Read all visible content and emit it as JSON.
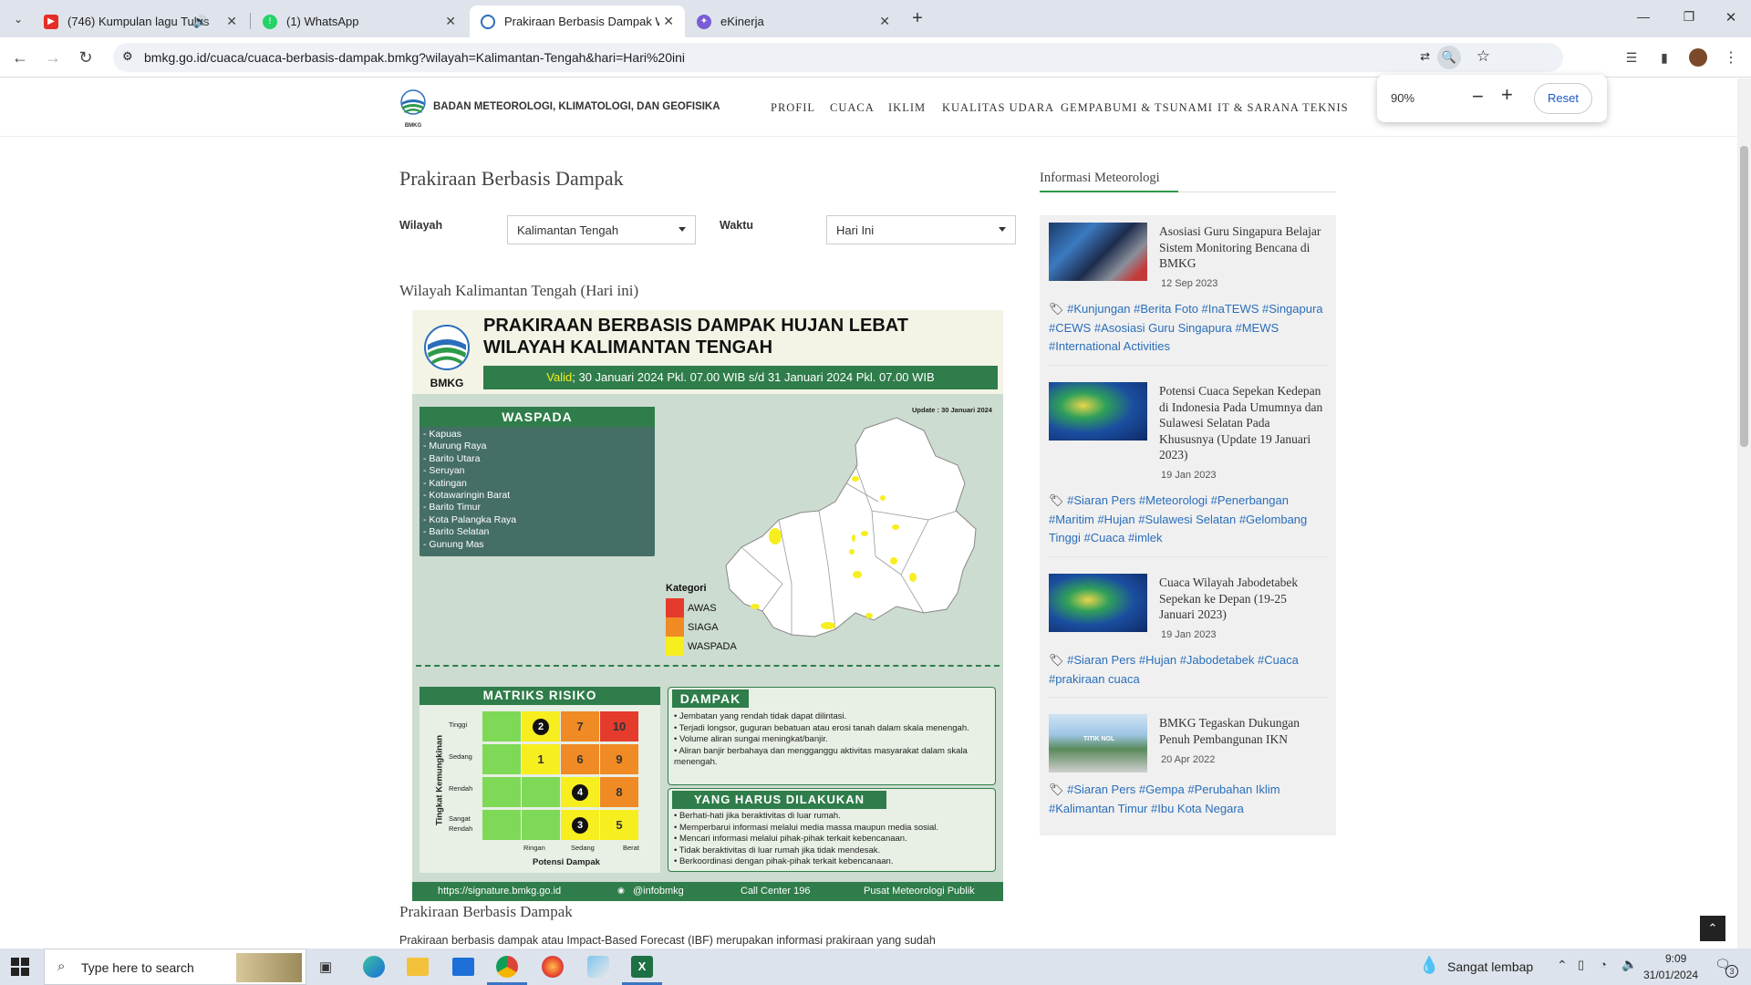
{
  "browser": {
    "tabs": [
      {
        "title": "(746) Kumpulan lagu Tulus",
        "favicon": "youtube-icon",
        "color": "#e52d27"
      },
      {
        "title": "(1) WhatsApp",
        "favicon": "whatsapp-icon",
        "color": "#25d366"
      },
      {
        "title": "Prakiraan Berbasis Dampak Wil",
        "favicon": "bmkg-icon",
        "color": "#2a6ebb"
      },
      {
        "title": "eKinerja",
        "favicon": "ekinerja-icon",
        "color": "#7b5cd6"
      }
    ],
    "url": "bmkg.go.id/cuaca/cuaca-berbasis-dampak.bmkg?wilayah=Kalimantan-Tengah&hari=Hari%20ini",
    "zoom": {
      "level": "90%",
      "minus": "−",
      "plus": "+",
      "reset": "Reset"
    }
  },
  "site": {
    "org_name": "BADAN METEOROLOGI, KLIMATOLOGI, DAN GEOFISIKA",
    "logo_text": "BMKG",
    "nav": [
      "PROFIL",
      "CUACA",
      "IKLIM",
      "KUALITAS UDARA",
      "GEMPABUMI & TSUNAMI",
      "IT & SARANA TEKNIS"
    ]
  },
  "main": {
    "title": "Prakiraan Berbasis Dampak",
    "wilayah_label": "Wilayah",
    "wilayah_value": "Kalimantan Tengah",
    "waktu_label": "Waktu",
    "waktu_value": "Hari Ini",
    "subtitle": "Wilayah Kalimantan Tengah (Hari ini)",
    "section_title": "Prakiraan Berbasis Dampak",
    "section_text": "Prakiraan berbasis dampak atau Impact-Based Forecast (IBF) merupakan informasi prakiraan yang sudah"
  },
  "infographic": {
    "logo_text": "BMKG",
    "title_line1": "PRAKIRAAN BERBASIS DAMPAK HUJAN LEBAT",
    "title_line2": "WILAYAH KALIMANTAN TENGAH",
    "valid_label": "Valid",
    "valid_text": "; 30 Januari 2024 Pkl. 07.00 WIB s/d 31 Januari 2024 Pkl. 07.00 WIB",
    "update": "Update : 30 Januari 2024",
    "waspada_title": "WASPADA",
    "waspada_list": [
      "- Kapuas",
      "- Murung Raya",
      "- Barito Utara",
      "- Seruyan",
      "- Katingan",
      "- Kotawaringin Barat",
      "- Barito Timur",
      "- Kota Palangka Raya",
      "- Barito Selatan",
      "- Gunung Mas"
    ],
    "kategori_title": "Kategori",
    "kategori": [
      {
        "label": "AWAS",
        "color": "#e53b2c"
      },
      {
        "label": "SIAGA",
        "color": "#f08a24"
      },
      {
        "label": "WASPADA",
        "color": "#f7ee1f"
      }
    ],
    "matriks_title": "MATRIKS RISIKO",
    "y_axis": "Tingkat Kemungkinan",
    "rows": [
      "Tinggi",
      "Sedang",
      "Rendah",
      "Sangat Rendah"
    ],
    "cols": [
      "Ringan",
      "Sedang",
      "Berat"
    ],
    "x_axis": "Potensi Dampak",
    "matrix": [
      [
        "",
        "2",
        "7",
        "10"
      ],
      [
        "",
        "1",
        "6",
        "9"
      ],
      [
        "",
        "",
        "4",
        "8"
      ],
      [
        "",
        "",
        "3",
        "5"
      ]
    ],
    "matrix_colors": [
      [
        "#7ed957",
        "#f7ee1f",
        "#f08a24",
        "#e53b2c"
      ],
      [
        "#7ed957",
        "#f7ee1f",
        "#f08a24",
        "#f08a24"
      ],
      [
        "#7ed957",
        "#7ed957",
        "#f7ee1f",
        "#f08a24"
      ],
      [
        "#7ed957",
        "#7ed957",
        "#f7ee1f",
        "#f7ee1f"
      ]
    ],
    "dampak_title": "DAMPAK",
    "dampak": [
      "• Jembatan yang rendah tidak dapat dilintasi.",
      "• Terjadi longsor, guguran bebatuan atau erosi tanah dalam skala menengah.",
      "• Volume aliran sungai meningkat/banjir.",
      "• Aliran banjir berbahaya dan mengganggu aktivitas masyarakat dalam skala menengah."
    ],
    "yhd_title": "YANG HARUS DILAKUKAN",
    "yhd": [
      "• Berhati-hati jika beraktivitas di luar rumah.",
      "• Memperbarui informasi melalui media massa maupun media sosial.",
      "• Mencari informasi melalui pihak-pihak terkait kebencanaan.",
      "• Tidak beraktivitas di luar rumah jika tidak mendesak.",
      "• Berkoordinasi dengan pihak-pihak terkait kebencanaan."
    ],
    "footer": [
      "https://signature.bmkg.go.id",
      "@infobmkg",
      "Call Center 196",
      "Pusat Meteorologi Publik"
    ]
  },
  "sidebar": {
    "title": "Informasi Meteorologi",
    "news": [
      {
        "title": "Asosiasi Guru Singapura Belajar Sistem Monitoring Bencana di BMKG",
        "date": "12 Sep 2023",
        "tags": "#Kunjungan #Berita Foto #InaTEWS #Singapura #CEWS #Asosiasi Guru Singapura #MEWS #International Activities"
      },
      {
        "title": "Potensi Cuaca Sepekan Kedepan di Indonesia Pada Umumnya dan Sulawesi Selatan Pada Khususnya (Update 19 Januari 2023)",
        "date": "19 Jan 2023",
        "tags": "#Siaran Pers #Meteorologi #Penerbangan #Maritim #Hujan #Sulawesi Selatan #Gelombang Tinggi #Cuaca #imlek"
      },
      {
        "title": "Cuaca Wilayah Jabodetabek Sepekan ke Depan (19-25 Januari 2023)",
        "date": "19 Jan 2023",
        "tags": "#Siaran Pers #Hujan #Jabodetabek #Cuaca #prakiraan cuaca"
      },
      {
        "title": "BMKG Tegaskan Dukungan Penuh Pembangunan IKN",
        "date": "20 Apr 2022",
        "tags": "#Siaran Pers #Gempa #Perubahan Iklim #Kalimantan Timur #Ibu Kota Negara"
      }
    ],
    "news4_img_text": "TITIK NOL"
  },
  "taskbar": {
    "search_placeholder": "Type here to search",
    "weather": "Sangat lembap",
    "time": "9:09",
    "date": "31/01/2024",
    "notif_count": "3"
  }
}
